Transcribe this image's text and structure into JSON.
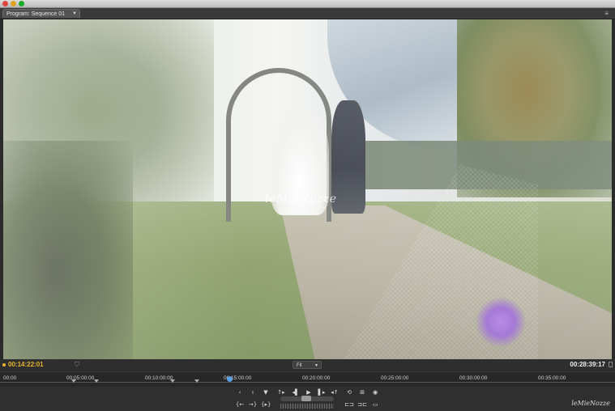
{
  "window": {
    "tab_label": "Program: Sequence 01",
    "menu_icon": "panel-menu-icon"
  },
  "monitor": {
    "watermark": "leMieNozze"
  },
  "transport": {
    "timecode_in": "00:14:22:01",
    "zoom": "Fit",
    "timecode_out": "00:28:39:17"
  },
  "ruler": {
    "ticks": [
      "00:00",
      "00:05:00:00",
      "00:10:00:00",
      "00:15:00:00",
      "00:20:00:00",
      "00:25:00:00",
      "00:30:00:00",
      "00:35:00:00"
    ],
    "playhead_position": "00:15:00:00"
  },
  "controls": {
    "row1": [
      "marker-prev-icon",
      "in-out-icon",
      "add-marker-icon",
      "mark-in-icon",
      "step-back-icon",
      "play-icon",
      "step-forward-icon",
      "mark-out-icon",
      "loop-icon",
      "safe-margins-icon",
      "output-icon"
    ],
    "row2": [
      "go-to-in-icon",
      "go-to-out-icon",
      "play-in-to-out-icon",
      "trim-icon",
      "lift-icon",
      "extract-icon",
      "export-frame-icon"
    ]
  },
  "branding": {
    "logo": "leMieNozze"
  }
}
